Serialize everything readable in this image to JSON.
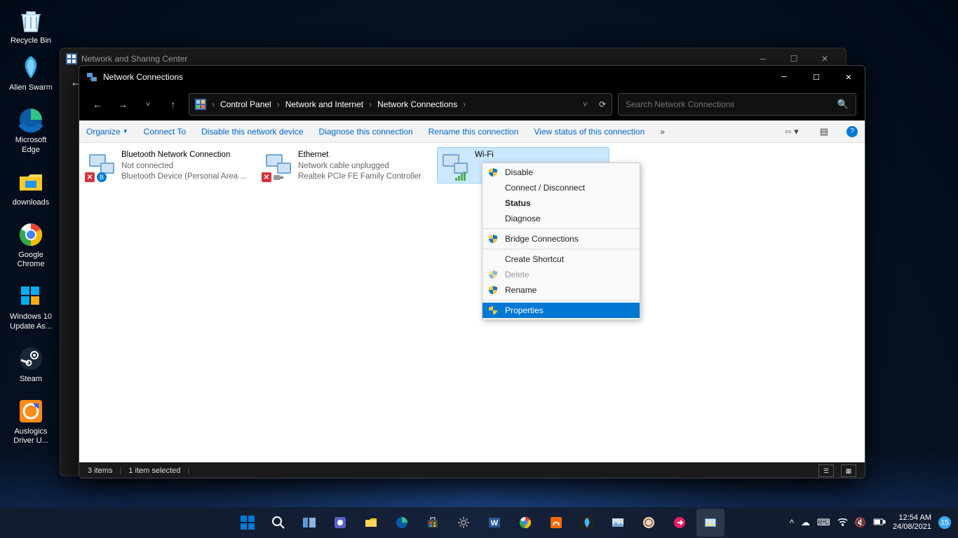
{
  "desktop": {
    "icons": [
      {
        "label": "Recycle Bin",
        "icon": "recycle"
      },
      {
        "label": "Alien Swarm",
        "icon": "alien"
      },
      {
        "label": "Microsoft Edge",
        "icon": "edge"
      },
      {
        "label": "downloads",
        "icon": "folder"
      },
      {
        "label": "Google Chrome",
        "icon": "chrome"
      },
      {
        "label": "Windows 10 Update As...",
        "icon": "win10"
      },
      {
        "label": "Steam",
        "icon": "steam"
      },
      {
        "label": "Auslogics Driver U...",
        "icon": "auslogics"
      }
    ]
  },
  "bg_window": {
    "title": "Network and Sharing Center"
  },
  "window": {
    "title": "Network Connections",
    "breadcrumb": [
      "Control Panel",
      "Network and Internet",
      "Network Connections"
    ],
    "search_placeholder": "Search Network Connections"
  },
  "toolbar": {
    "organize": "Organize",
    "items": [
      "Connect To",
      "Disable this network device",
      "Diagnose this connection",
      "Rename this connection",
      "View status of this connection"
    ]
  },
  "adapters": [
    {
      "name": "Bluetooth Network Connection",
      "status": "Not connected",
      "device": "Bluetooth Device (Personal Area ...",
      "error": true,
      "overlay": "bluetooth"
    },
    {
      "name": "Ethernet",
      "status": "Network cable unplugged",
      "device": "Realtek PCIe FE Family Controller",
      "error": true,
      "overlay": "plug"
    },
    {
      "name": "Wi-Fi",
      "status": "",
      "device": "",
      "selected": true,
      "overlay": "wifi"
    }
  ],
  "context_menu": {
    "items": [
      {
        "label": "Disable",
        "shield": true
      },
      {
        "label": "Connect / Disconnect"
      },
      {
        "label": "Status",
        "bold": true
      },
      {
        "label": "Diagnose"
      },
      {
        "sep": true
      },
      {
        "label": "Bridge Connections",
        "shield": true
      },
      {
        "sep": true
      },
      {
        "label": "Create Shortcut"
      },
      {
        "label": "Delete",
        "shield": true,
        "disabled": true
      },
      {
        "label": "Rename",
        "shield": true
      },
      {
        "sep": true
      },
      {
        "label": "Properties",
        "shield": true,
        "highlighted": true
      }
    ]
  },
  "statusbar": {
    "count": "3 items",
    "selected": "1 item selected"
  },
  "taskbar": {
    "time": "12:54 AM",
    "date": "24/08/2021",
    "notif_count": "15"
  }
}
